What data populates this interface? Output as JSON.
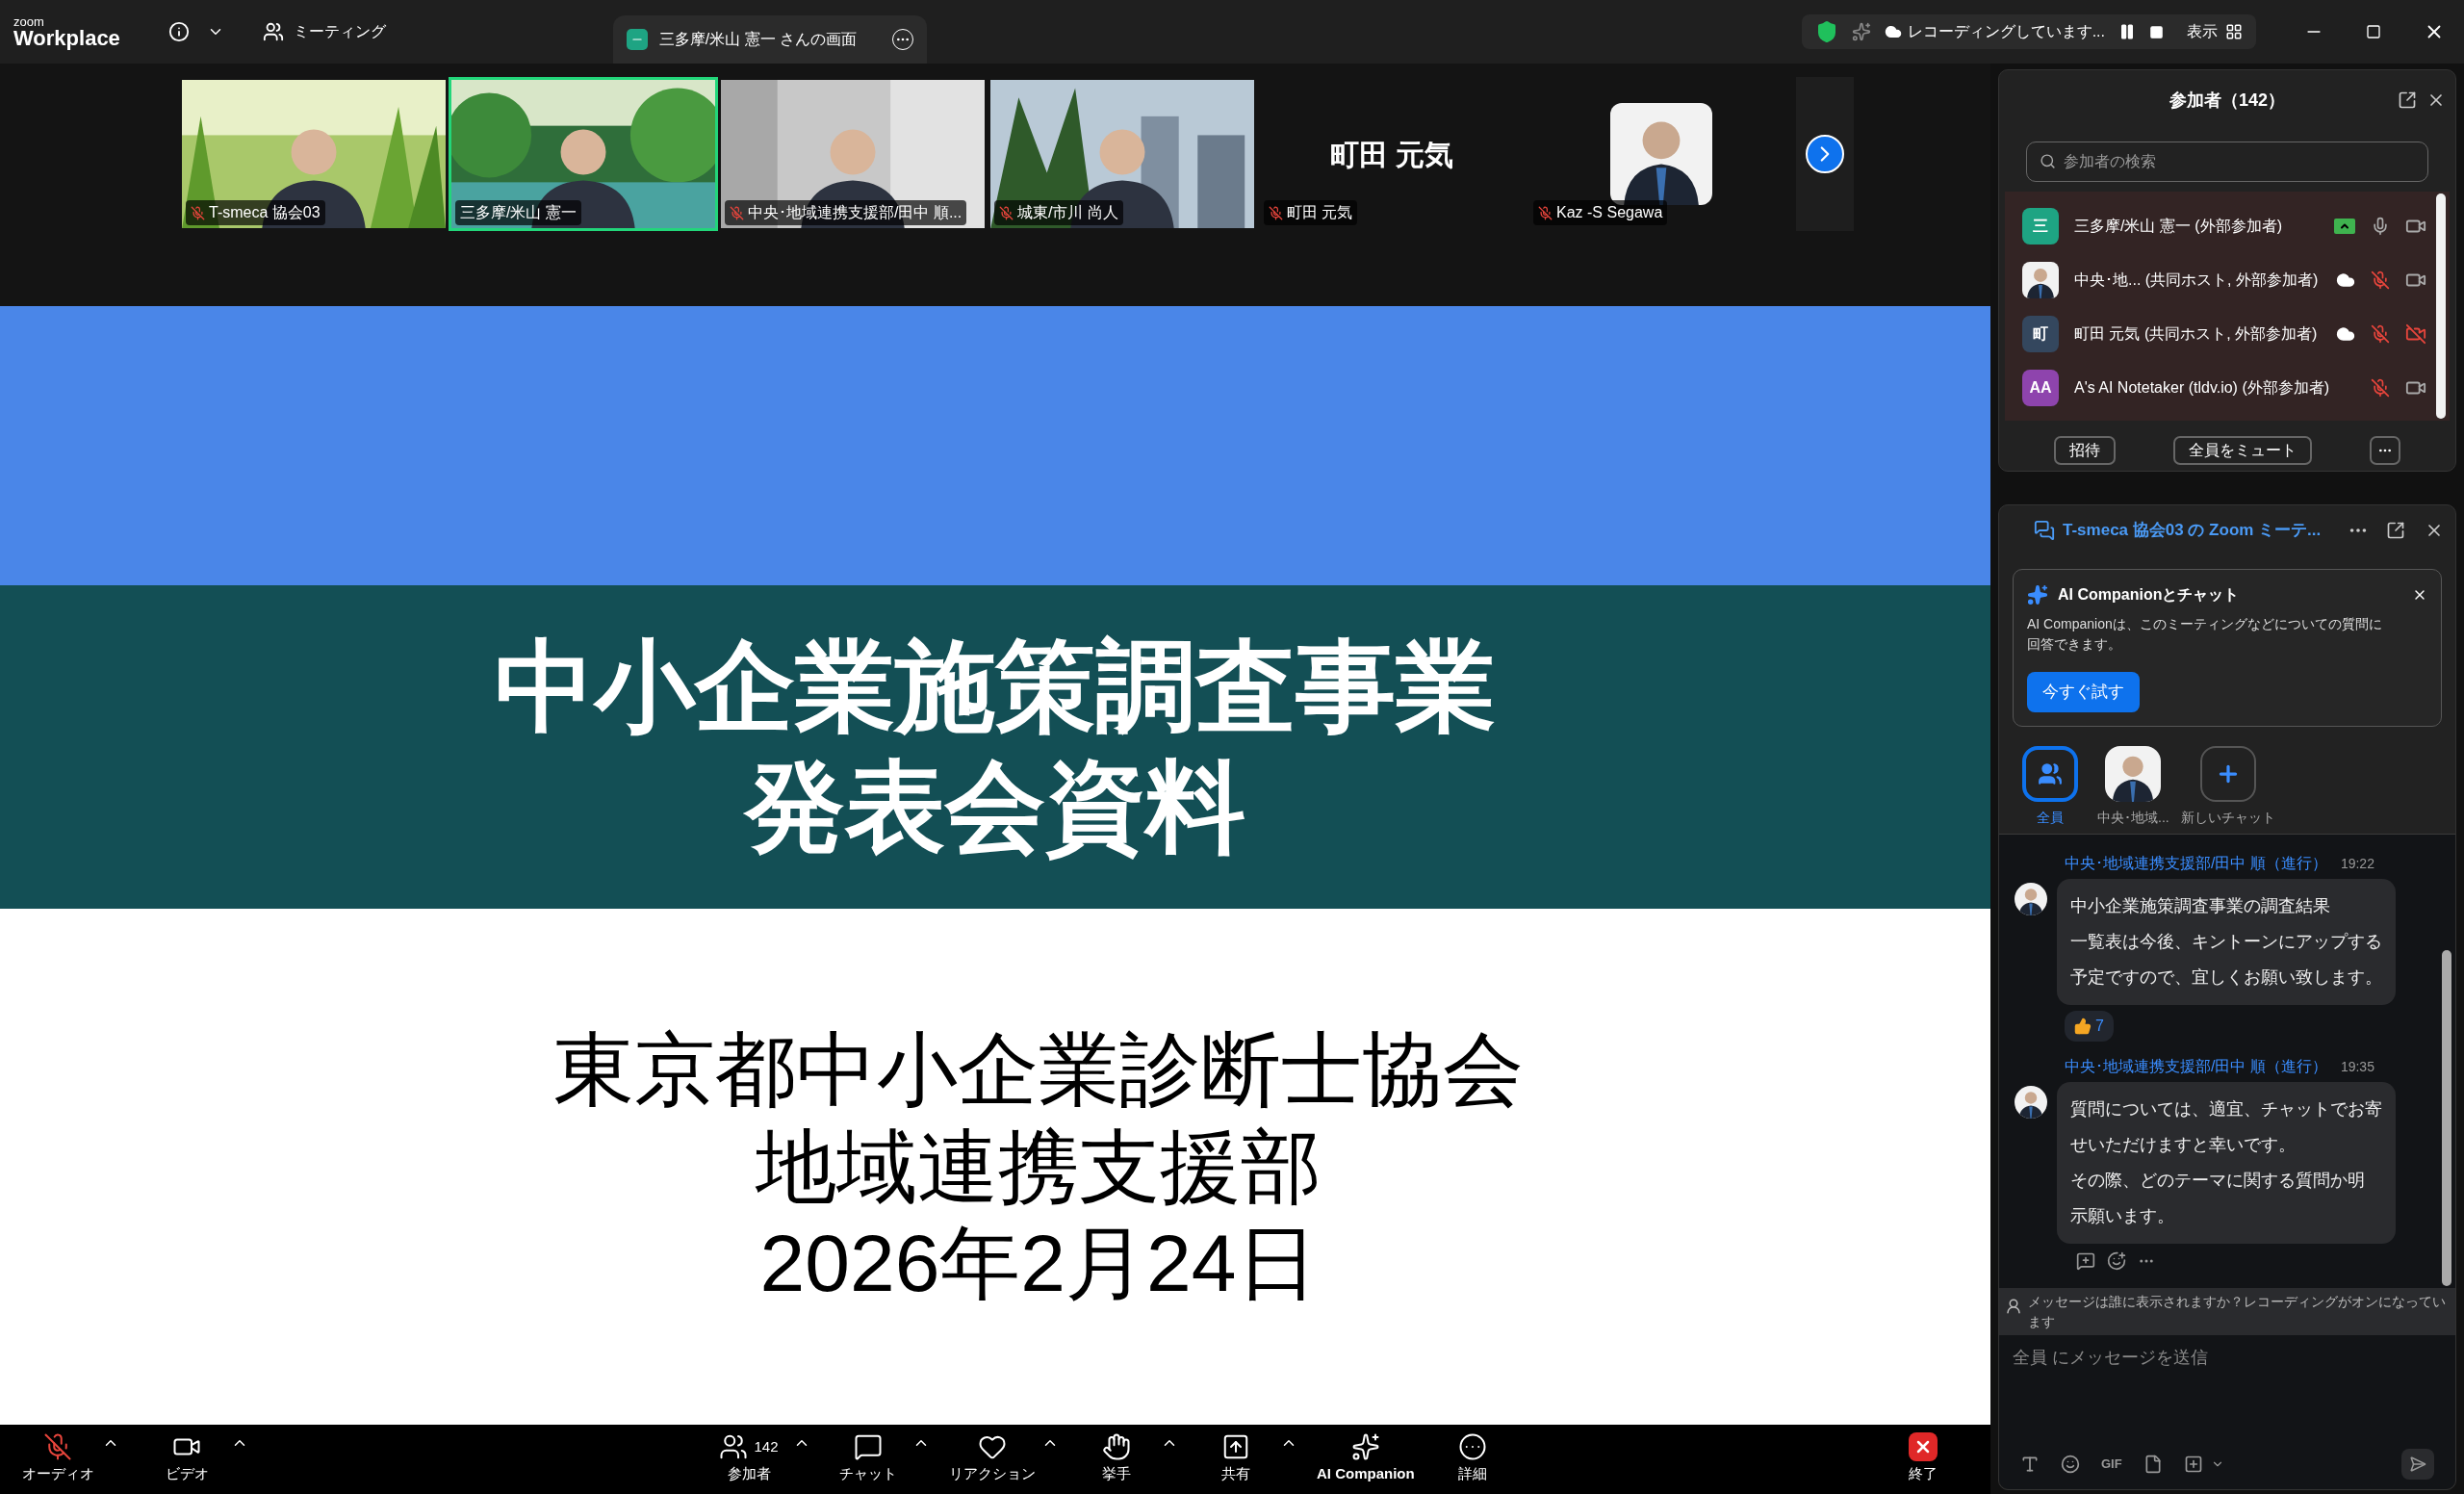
{
  "title_bar": {
    "logo_top": "zoom",
    "logo_bottom": "Workplace",
    "meeting_menu": "ミーティング",
    "share_tab": "三多摩/米山 憲一 さんの画面",
    "recording": "レコーディングしています...",
    "view": "表示"
  },
  "video_strip": [
    {
      "kind": "video",
      "name": "T-smeca 協会03",
      "muted": true,
      "selected": false
    },
    {
      "kind": "video",
      "name": "三多摩/米山 憲一",
      "muted": false,
      "selected": true
    },
    {
      "kind": "video",
      "name": "中央･地域連携支援部/田中 順...",
      "muted": true,
      "selected": false
    },
    {
      "kind": "video",
      "name": "城東/市川 尚人",
      "muted": true,
      "selected": false
    },
    {
      "kind": "name",
      "name": "町田 元気",
      "big_name": "町田 元気",
      "muted": true,
      "selected": false
    },
    {
      "kind": "avatar",
      "name": "Kaz -S Segawa",
      "muted": true,
      "selected": false
    }
  ],
  "slide": {
    "title_lines": [
      "中小企業施策調査事業",
      "発表会資料"
    ],
    "body_lines": [
      "東京都中小企業診断士協会",
      "地域連携支援部",
      "2026年2月24日"
    ]
  },
  "participants": {
    "title": "参加者（142）",
    "search_placeholder": "参加者の検索",
    "list": [
      {
        "avatar_text": "三",
        "color": "#1ea483",
        "name": "三多摩/米山 憲一 (外部参加者)",
        "sharing": true,
        "recording": false,
        "mic_muted": false,
        "video_off": false
      },
      {
        "name": "中央･地...  (共同ホスト, 外部参加者)",
        "sharing": false,
        "recording": true,
        "mic_muted": true,
        "video_off": false
      },
      {
        "avatar_text": "町",
        "color": "#34475e",
        "name": "町田 元気 (共同ホスト, 外部参加者)",
        "sharing": false,
        "recording": true,
        "mic_muted": true,
        "video_off": true
      },
      {
        "avatar_text": "AA",
        "color": "#8e44ad",
        "name": "A's AI Notetaker (tldv.io) (外部参加者)",
        "sharing": false,
        "recording": false,
        "mic_muted": true,
        "video_off": false
      }
    ],
    "buttons": [
      "招待",
      "全員をミュート"
    ]
  },
  "chat": {
    "title": "T-smeca 協会03 の Zoom ミーテ...",
    "ai_card": {
      "title": "AI Companionとチャット",
      "text": "AI Companionは、このミーティングなどについての質問に回答できます。",
      "button": "今すぐ試す"
    },
    "recipients": [
      {
        "kind": "everyone",
        "label": "全員",
        "selected": true
      },
      {
        "kind": "person",
        "label": "中央･地域...",
        "selected": false
      },
      {
        "kind": "new",
        "label": "新しいチャット",
        "selected": false
      }
    ],
    "messages": [
      {
        "sender": "中央･地域連携支援部/田中 順（進行）",
        "time": "19:22",
        "lines": [
          "中小企業施策調査事業の調査結果",
          "一覧表は今後、キントーンにアップする",
          "予定ですので、宜しくお願い致します。"
        ],
        "reaction_count": "7"
      },
      {
        "sender": "中央･地域連携支援部/田中 順（進行）",
        "time": "19:35",
        "lines": [
          "質問については、適宜、チャットでお寄",
          "せいただけますと幸いです。",
          "その際、どのテーマに関する質問か明",
          "示願います。"
        ],
        "actions": true
      }
    ],
    "notice": "メッセージは誰に表示されますか？レコーディングがオンになっています",
    "input_placeholder": "全員 にメッセージを送信",
    "gif": "GIF"
  },
  "toolbar": [
    {
      "kind": "audio",
      "label": "オーディオ",
      "muted": true
    },
    {
      "kind": "video",
      "label": "ビデオ"
    },
    {
      "kind": "participants",
      "label": "参加者",
      "count": "142"
    },
    {
      "kind": "chat",
      "label": "チャット"
    },
    {
      "kind": "reaction",
      "label": "リアクション"
    },
    {
      "kind": "raise",
      "label": "挙手"
    },
    {
      "kind": "share",
      "label": "共有"
    },
    {
      "kind": "ai",
      "label": "AI Companion"
    },
    {
      "kind": "more",
      "label": "詳細"
    },
    {
      "kind": "end",
      "label": "終了"
    }
  ]
}
